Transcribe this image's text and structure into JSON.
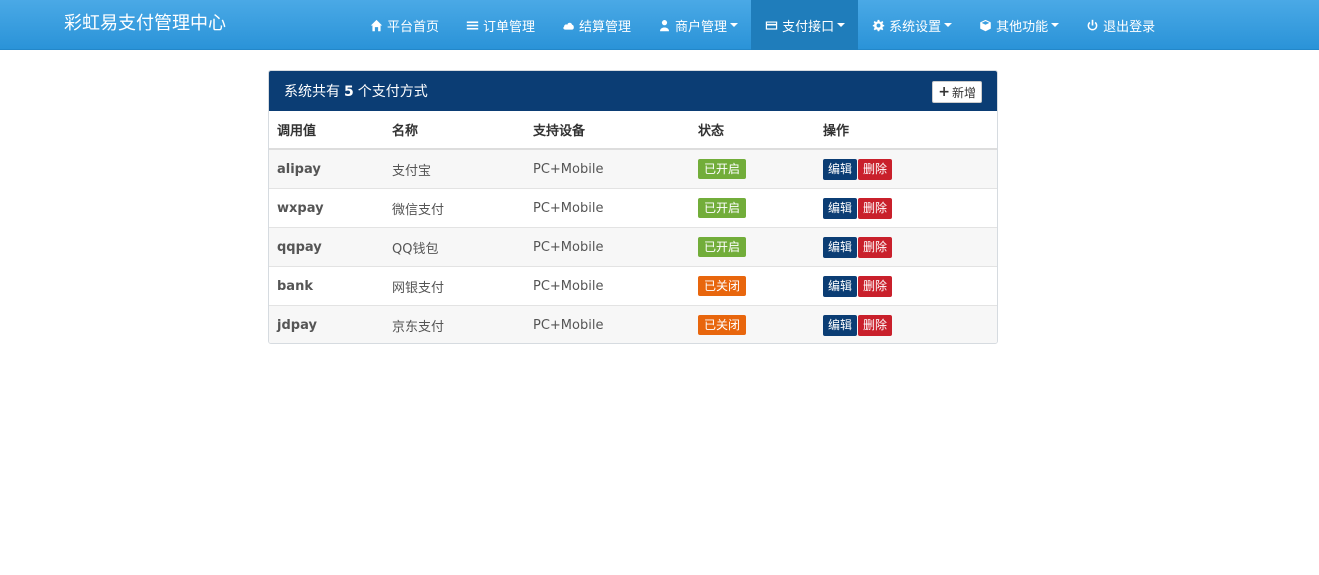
{
  "brand": "彩虹易支付管理中心",
  "nav": [
    {
      "label": "平台首页",
      "icon": "home-icon",
      "dropdown": false
    },
    {
      "label": "订单管理",
      "icon": "list-icon",
      "dropdown": false
    },
    {
      "label": "结算管理",
      "icon": "cloud-icon",
      "dropdown": false
    },
    {
      "label": "商户管理",
      "icon": "user-icon",
      "dropdown": true
    },
    {
      "label": "支付接口",
      "icon": "credit-card-icon",
      "dropdown": true,
      "active": true
    },
    {
      "label": "系统设置",
      "icon": "gear-icon",
      "dropdown": true
    },
    {
      "label": "其他功能",
      "icon": "cube-icon",
      "dropdown": true
    },
    {
      "label": "退出登录",
      "icon": "power-icon",
      "dropdown": false
    }
  ],
  "panel": {
    "title_prefix": "系统共有",
    "count": "5",
    "title_suffix": "个支付方式",
    "add_label": "新增"
  },
  "table": {
    "headers": [
      "调用值",
      "名称",
      "支持设备",
      "状态",
      "操作"
    ],
    "rows": [
      {
        "code": "alipay",
        "name": "支付宝",
        "device": "PC+Mobile",
        "status": "已开启",
        "status_type": "on"
      },
      {
        "code": "wxpay",
        "name": "微信支付",
        "device": "PC+Mobile",
        "status": "已开启",
        "status_type": "on"
      },
      {
        "code": "qqpay",
        "name": "QQ钱包",
        "device": "PC+Mobile",
        "status": "已开启",
        "status_type": "on"
      },
      {
        "code": "bank",
        "name": "网银支付",
        "device": "PC+Mobile",
        "status": "已关闭",
        "status_type": "off"
      },
      {
        "code": "jdpay",
        "name": "京东支付",
        "device": "PC+Mobile",
        "status": "已关闭",
        "status_type": "off"
      }
    ],
    "edit_label": "编辑",
    "delete_label": "删除"
  },
  "colors": {
    "navbar": "#2a93d8",
    "panel_header": "#0b3d74",
    "status_on": "#72ad3a",
    "status_off": "#e8660d",
    "edit": "#0b3d74",
    "delete": "#c9202b"
  }
}
